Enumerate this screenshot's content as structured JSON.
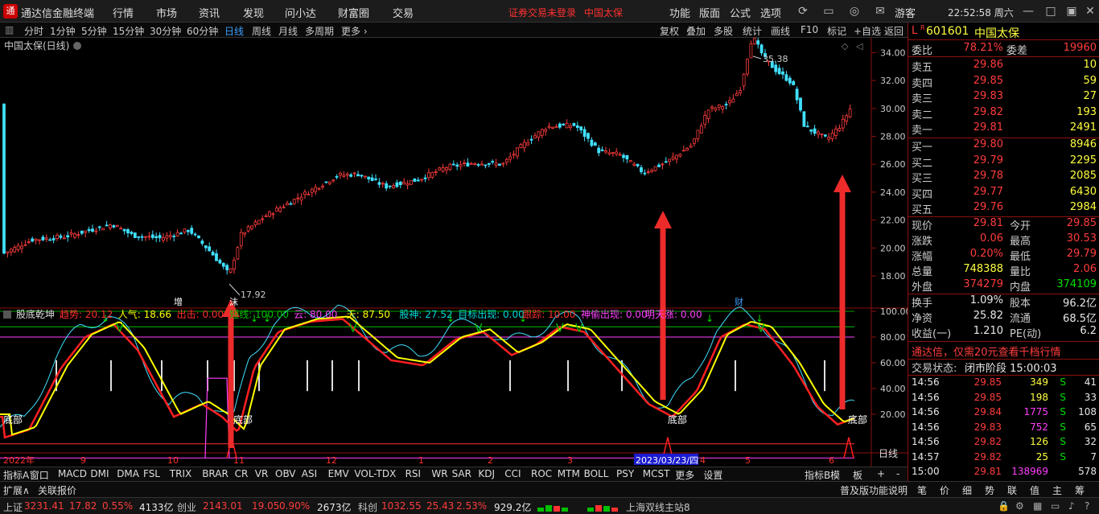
{
  "app": {
    "title": "通达信金融终端",
    "menu": [
      "行情",
      "市场",
      "资讯",
      "发现",
      "问小达",
      "财富圈",
      "交易"
    ],
    "warning": "证券交易未登录",
    "stock_label": "中国太保",
    "right_menu": [
      "功能",
      "版面",
      "公式",
      "选项"
    ],
    "user": "游客",
    "clock": "22:52:58 周六"
  },
  "toolbar": {
    "periods": [
      "分时",
      "1分钟",
      "5分钟",
      "15分钟",
      "30分钟",
      "60分钟",
      "日线",
      "周线",
      "月线",
      "多周期",
      "更多 ›"
    ],
    "active_period": "日线",
    "right_buttons": [
      "复权",
      "叠加",
      "多股",
      "统计",
      "画线",
      "F10",
      "标记",
      "+自选",
      "返回"
    ]
  },
  "chart": {
    "title": "中国太保(日线)",
    "y_ticks": [
      "34.00",
      "32.00",
      "30.00",
      "28.00",
      "26.00",
      "24.00",
      "22.00",
      "20.00",
      "18.00"
    ],
    "high_label": "35.38",
    "low_label": "17.92",
    "markers": {
      "zeng": "增",
      "jie": "沫",
      "cai": "财"
    },
    "x_labels": [
      "2022年",
      "9",
      "10",
      "11",
      "12",
      "1",
      "2",
      "3",
      "2023/03/23/四",
      "4",
      "5",
      "6"
    ],
    "period_label": "日线"
  },
  "indicator": {
    "name": "股底乾坤",
    "values": [
      {
        "label": "趋势",
        "value": "20.12",
        "color": "#ff3030"
      },
      {
        "label": "人气",
        "value": "18.66",
        "color": "#ffff00"
      },
      {
        "label": "出击",
        "value": "0.00",
        "color": "#ff3030"
      },
      {
        "label": "短线",
        "value": "100.00",
        "color": "#00c000"
      },
      {
        "label": "云",
        "value": "80.00",
        "color": "#ff40ff"
      },
      {
        "label": "天",
        "value": "87.50",
        "color": "#ffff00"
      },
      {
        "label": "股神",
        "value": "27.52",
        "color": "#00d8d8"
      },
      {
        "label": "目标出现",
        "value": "0.00",
        "color": "#00d8d8"
      },
      {
        "label": "跟踪",
        "value": "10.00",
        "color": "#ff3030"
      },
      {
        "label": "神偷出现",
        "value": "0.00",
        "color": "#ff40ff"
      },
      {
        "label": "明天涨",
        "value": "0.00",
        "color": "#ff40ff"
      }
    ],
    "y_ticks": [
      "100.00",
      "80.00",
      "60.00",
      "40.00",
      "20.00"
    ],
    "bottom_label": "底部"
  },
  "tabs": [
    "指标A",
    "窗口",
    "MACD",
    "DMI",
    "DMA",
    "FSL",
    "TRIX",
    "BRAR",
    "CR",
    "VR",
    "OBV",
    "ASI",
    "EMV",
    "VOL-TDX",
    "RSI",
    "WR",
    "SAR",
    "KDJ",
    "CCI",
    "ROC",
    "MTM",
    "BOLL",
    "PSY",
    "MCST",
    "更多",
    "设置"
  ],
  "tabs_right": [
    "指标B",
    "模",
    "板",
    "+",
    "-"
  ],
  "bottom": {
    "left": [
      "扩展∧",
      "关联报价"
    ],
    "right_text": "普及版功能说明",
    "right_tabs": [
      "笔",
      "价",
      "细",
      "势",
      "联",
      "值",
      "主",
      "筹"
    ]
  },
  "quote": {
    "code": "601601",
    "name": "中国太保",
    "weibi_label": "委比",
    "weibi": "78.21%",
    "weicha_label": "委差",
    "weicha": "19960",
    "asks": [
      {
        "label": "卖五",
        "price": "29.86",
        "vol": "10"
      },
      {
        "label": "卖四",
        "price": "29.85",
        "vol": "59"
      },
      {
        "label": "卖三",
        "price": "29.83",
        "vol": "27"
      },
      {
        "label": "卖二",
        "price": "29.82",
        "vol": "193"
      },
      {
        "label": "卖一",
        "price": "29.81",
        "vol": "2491"
      }
    ],
    "bids": [
      {
        "label": "买一",
        "price": "29.80",
        "vol": "8946"
      },
      {
        "label": "买二",
        "price": "29.79",
        "vol": "2295"
      },
      {
        "label": "买三",
        "price": "29.78",
        "vol": "2085"
      },
      {
        "label": "买四",
        "price": "29.77",
        "vol": "6430"
      },
      {
        "label": "买五",
        "price": "29.76",
        "vol": "2984"
      }
    ],
    "stats": [
      {
        "l1": "现价",
        "v1": "29.81",
        "c1": "red",
        "l2": "今开",
        "v2": "29.85",
        "c2": "red"
      },
      {
        "l1": "涨跌",
        "v1": "0.06",
        "c1": "red",
        "l2": "最高",
        "v2": "30.53",
        "c2": "red"
      },
      {
        "l1": "涨幅",
        "v1": "0.20%",
        "c1": "red",
        "l2": "最低",
        "v2": "29.79",
        "c2": "red"
      },
      {
        "l1": "总量",
        "v1": "748388",
        "c1": "yellow",
        "l2": "量比",
        "v2": "2.06",
        "c2": "red"
      },
      {
        "l1": "外盘",
        "v1": "374279",
        "c1": "red",
        "l2": "内盘",
        "v2": "374109",
        "c2": "green"
      }
    ],
    "stats2": [
      {
        "l1": "换手",
        "v1": "1.09%",
        "l2": "股本",
        "v2": "96.2亿"
      },
      {
        "l1": "净资",
        "v1": "25.82",
        "l2": "流通",
        "v2": "68.5亿"
      },
      {
        "l1": "收益(一)",
        "v1": "1.210",
        "l2": "PE(动)",
        "v2": "6.2"
      }
    ],
    "ad": "通达信，仅需20元查看千档行情",
    "trade_status_label": "交易状态:",
    "trade_status": "闭市阶段 15:00:03",
    "ticks": [
      {
        "t": "14:56",
        "p": "29.85",
        "v": "349",
        "s": "S",
        "n": "41",
        "vc": "yellow"
      },
      {
        "t": "14:56",
        "p": "29.85",
        "v": "198",
        "s": "S",
        "n": "33",
        "vc": "yellow"
      },
      {
        "t": "14:56",
        "p": "29.84",
        "v": "1775",
        "s": "S",
        "n": "108",
        "vc": "mag"
      },
      {
        "t": "14:56",
        "p": "29.83",
        "v": "752",
        "s": "S",
        "n": "65",
        "vc": "mag"
      },
      {
        "t": "14:56",
        "p": "29.82",
        "v": "126",
        "s": "S",
        "n": "32",
        "vc": "yellow"
      },
      {
        "t": "14:57",
        "p": "29.82",
        "v": "25",
        "s": "S",
        "n": "7",
        "vc": "yellow"
      },
      {
        "t": "15:00",
        "p": "29.81",
        "v": "138969",
        "s": "",
        "n": "578",
        "vc": "mag"
      }
    ]
  },
  "status": {
    "items": [
      {
        "label": "上证",
        "value": "3231.41",
        "chg": "17.82",
        "pct": "0.55%",
        "amt": "4133亿"
      },
      {
        "label": "创业",
        "value": "2143.01",
        "chg": "19.05",
        "pct": "0.90%",
        "amt": "2673亿"
      },
      {
        "label": "科创",
        "value": "1032.55",
        "chg": "25.43",
        "pct": "2.53%",
        "amt": "929.2亿"
      }
    ],
    "server": "上海双线主站8"
  }
}
